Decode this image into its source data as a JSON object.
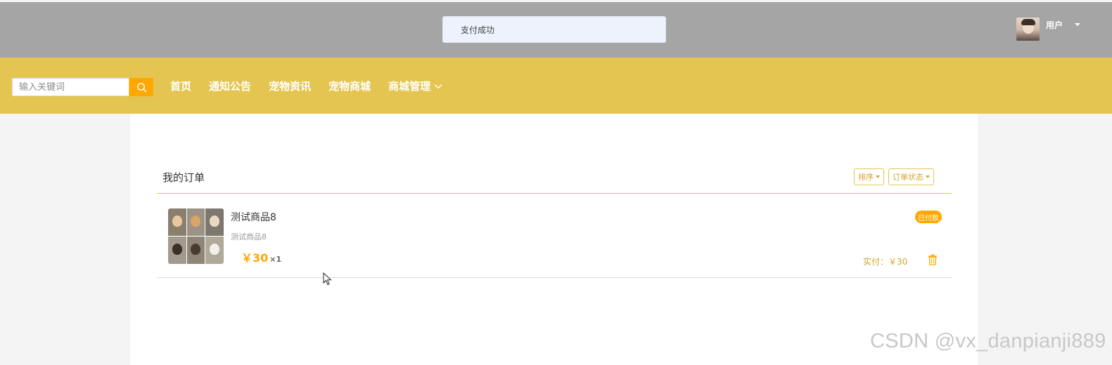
{
  "toast": {
    "message": "支付成功"
  },
  "user": {
    "name": "用户"
  },
  "search": {
    "placeholder": "输入关键词"
  },
  "nav": {
    "items": [
      {
        "label": "首页"
      },
      {
        "label": "通知公告"
      },
      {
        "label": "宠物资讯"
      },
      {
        "label": "宠物商城"
      },
      {
        "label": "商城管理"
      }
    ]
  },
  "orders": {
    "title": "我的订单",
    "sort_label": "排序",
    "status_filter_label": "订单状态",
    "items": [
      {
        "name": "测试商品8",
        "subtitle": "测试商品8",
        "price": "￥30",
        "quantity": "×1",
        "status": "已付款",
        "paid": "实付：￥30"
      }
    ]
  },
  "watermark": "CSDN @vx_danpianji889",
  "colors": {
    "navbar": "#e5c551",
    "accent": "#ffa800",
    "overlay_header": "#a5a5a5"
  }
}
